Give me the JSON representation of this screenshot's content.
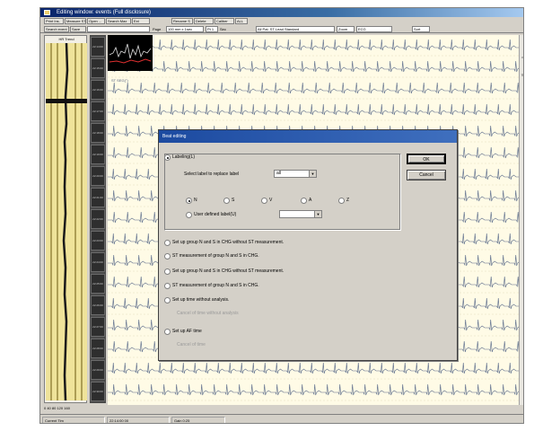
{
  "window": {
    "title": "Editing window: events (Full disclosure)"
  },
  "toolbar1": {
    "buttons": [
      "Print Ins.",
      "Measure ST",
      "Open ...",
      "Search Max",
      "Ext",
      "Rename S",
      "Delete",
      "Caliber",
      "ALL"
    ]
  },
  "toolbar2": {
    "buttons": [
      "Search event",
      "Save"
    ],
    "fields": [
      "Page",
      "100 mm x 1sec",
      "Pt 1",
      "Sec",
      "All Pat. ST Lead Standard",
      "Zoom",
      "ECG",
      "Sort"
    ]
  },
  "trend": {
    "header": "HR Trend",
    "footer": "0  40  80  120 160"
  },
  "time_cells": [
    "22:14:00",
    "22:15:00",
    "22:16:00",
    "22:17:00",
    "22:18:00",
    "22:19:00",
    "22:20:00",
    "22:21:00",
    "22:22:00",
    "22:23:00",
    "22:24:00",
    "22:25:00",
    "22:26:00",
    "22:27:00",
    "22:28:00",
    "22:29:00",
    "22:30:00"
  ],
  "ecg": {
    "strip_label": "ST SEG(°)"
  },
  "statusbar": {
    "left": "Current Tim",
    "middle": "22:14:00 00",
    "right": "Gain 0:25"
  },
  "dialog": {
    "title": "Beat editing",
    "labeling": "Labeling(L)",
    "select_label_text": "Select label to replace label",
    "select_label_value": "all",
    "beat_types": [
      "N",
      "S",
      "V",
      "A",
      "Z"
    ],
    "user_defined_label": "User defined label(U)",
    "options": [
      "Set up group N and S in CHG without ST measurement.",
      "ST measurement of group N and S in CHG.",
      "Set up group N and S in CHG without ST measurement.",
      "ST measurement of group N and S in CHG.",
      "Set up time without analysis."
    ],
    "dim_option_1": "Cancel of time without analysis",
    "af_option": "Set up AF time",
    "dim_option_2": "Cancel of time",
    "ok_label": "OK",
    "cancel_label": "Cancel"
  }
}
